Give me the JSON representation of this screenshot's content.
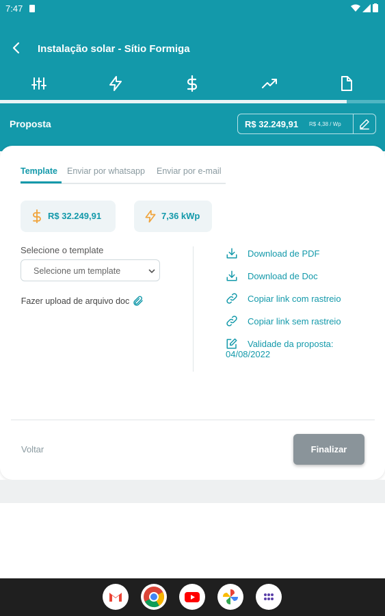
{
  "status_bar": {
    "time": "7:47"
  },
  "app_bar": {
    "title": "Instalação solar - Sítio Formiga"
  },
  "steps": {
    "icons": [
      "sliders-icon",
      "lightning-icon",
      "dollar-icon",
      "trending-up-icon",
      "document-icon"
    ],
    "progress_fraction": 0.9
  },
  "proposal_bar": {
    "label": "Proposta",
    "price": "R$ 32.249,91",
    "price_per_wp": "R$ 4,38 / Wp"
  },
  "subtabs": [
    "Template",
    "Enviar por whatsapp",
    "Enviar por e-mail"
  ],
  "summary": {
    "total": "R$ 32.249,91",
    "power": "7,36 kWp"
  },
  "template_section": {
    "label": "Selecione o template",
    "select_value": "Selecione um template",
    "upload_text": "Fazer upload de arquivo doc"
  },
  "actions": [
    {
      "label": "Download de PDF",
      "icon": "download-icon"
    },
    {
      "label": "Download de Doc",
      "icon": "download-icon"
    },
    {
      "label": "Copiar link com rastreio",
      "icon": "link-icon"
    },
    {
      "label": "Copiar link sem rastreio",
      "icon": "link-icon"
    },
    {
      "label": "Validade da proposta: 04/08/2022",
      "icon": "edit-icon"
    }
  ],
  "footer": {
    "back_label": "Voltar",
    "finish_label": "Finalizar"
  },
  "colors": {
    "primary": "#1399aa",
    "accent": "#f0a33a",
    "button_disabled": "#8a949a"
  }
}
